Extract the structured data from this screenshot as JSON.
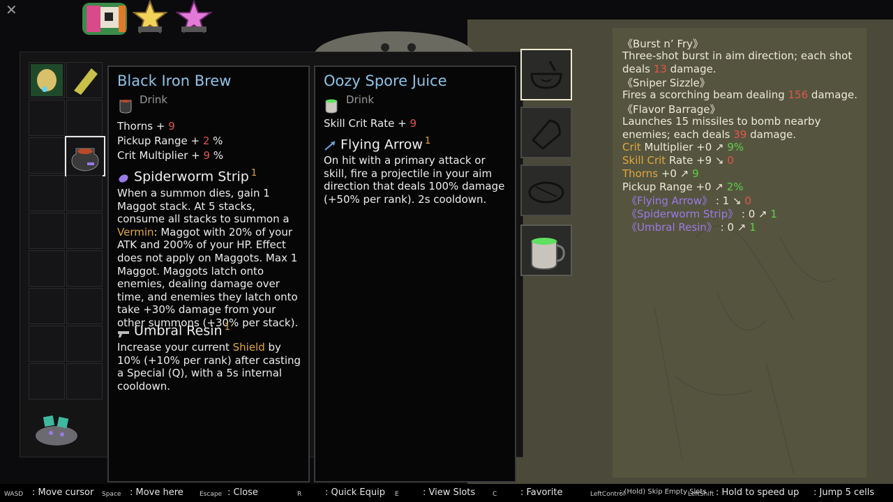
{
  "hud": {
    "close_glyph": "✕",
    "items": [
      "backpack-icon",
      "star-icon",
      "pink-star-icon"
    ]
  },
  "panel_left": {
    "title": "Black Iron Brew",
    "type": "Drink",
    "stats": [
      {
        "label": "Thorns + ",
        "value": "9",
        "unit": ""
      },
      {
        "label": "Pickup Range + ",
        "value": "2",
        "unit": " %"
      },
      {
        "label": "Crit Multiplier + ",
        "value": "9",
        "unit": " %"
      }
    ],
    "skill1": {
      "name": "Spiderworm Strip",
      "level": "1",
      "desc_a": "When a summon dies, gain 1 Maggot stack. At 5 stacks, consume all stacks to summon a ",
      "desc_hl": "Vermin",
      "desc_b": ": Maggot with 20% of your ATK and 200% of your HP. Effect does not apply on Maggots. Max 1 Maggot. Maggots latch onto enemies, dealing damage over time, and enemies they latch onto take +30% damage from your other summons (+30% per stack)."
    },
    "skill2": {
      "name": "Umbral Resin",
      "level": "1",
      "desc_a": "Increase your current ",
      "desc_hl": "Shield",
      "desc_b": " by 10% (+10% per rank) after casting a Special (Q), with a 5s internal cooldown."
    }
  },
  "panel_mid": {
    "title": "Oozy Spore Juice",
    "type": "Drink",
    "stat": {
      "label": "Skill Crit Rate + ",
      "value": "9"
    },
    "skill1": {
      "name": "Flying Arrow",
      "level": "1",
      "desc": "On hit with a primary attack or skill, fire a projectile in your aim direction that deals 100% damage (+50% per rank). 2s cooldown."
    }
  },
  "parchment": {
    "burst_title": "《Burst n’ Fry》",
    "burst_a": "Three-shot burst in aim direction; each shot",
    "burst_b1": "deals ",
    "burst_b2": "13",
    "burst_b3": " damage.",
    "sniper_title": "《Sniper Sizzle》",
    "sniper_a": "Fires a scorching beam dealing ",
    "sniper_b": "156",
    "sniper_c": " damage.",
    "flavor_title": "《Flavor Barrage》",
    "flavor_a": "Launches 15 missiles to bomb nearby",
    "flavor_b1": "enemies; each deals ",
    "flavor_b2": "39",
    "flavor_b3": " damage.",
    "cm_label": "Crit",
    "cm_rest": " Multiplier +0 ↗ ",
    "cm_val": "9%",
    "scr_label": "Skill Crit",
    "scr_rest": " Rate +9 ↘ ",
    "scr_val": "0",
    "th_label": "Thorns",
    "th_rest": " +0 ↗ ",
    "th_val": "9",
    "pr_label": "Pickup Range +0 ↗ ",
    "pr_val": "2%",
    "fa_name": "《Flying Arrow》",
    "fa_rest": "  : 1 ↘ ",
    "fa_val": "0",
    "ss_name": "《Spiderworm Strip》",
    "ss_rest": "  : 0 ↗ ",
    "ss_val": "1",
    "ur_name": "《Umbral Resin》",
    "ur_rest": "  : 0 ↗ ",
    "ur_val": "1"
  },
  "footer": [
    {
      "key": "WASD",
      "label": ": Move cursor"
    },
    {
      "key": "Space",
      "label": ": Move here"
    },
    {
      "key": "Escape",
      "label": ": Close"
    },
    {
      "key": "R",
      "label": ": Quick Equip"
    },
    {
      "key": "E",
      "label": ": View Slots"
    },
    {
      "key": "C",
      "label": ": Favorite"
    },
    {
      "key": "LeftControl",
      "label": ": (Hold) Skip Empty Slots"
    },
    {
      "key": "LeftShift",
      "label": ": Hold to speed up"
    },
    {
      "key": "",
      "label": ": Jump 5 cells"
    }
  ],
  "colors": {
    "title": "#8fc3e6",
    "red": "#e2554c",
    "gold": "#e3a63c",
    "green": "#5fcf4a",
    "purple": "#9a7ae8",
    "parchment": "#55553f"
  }
}
